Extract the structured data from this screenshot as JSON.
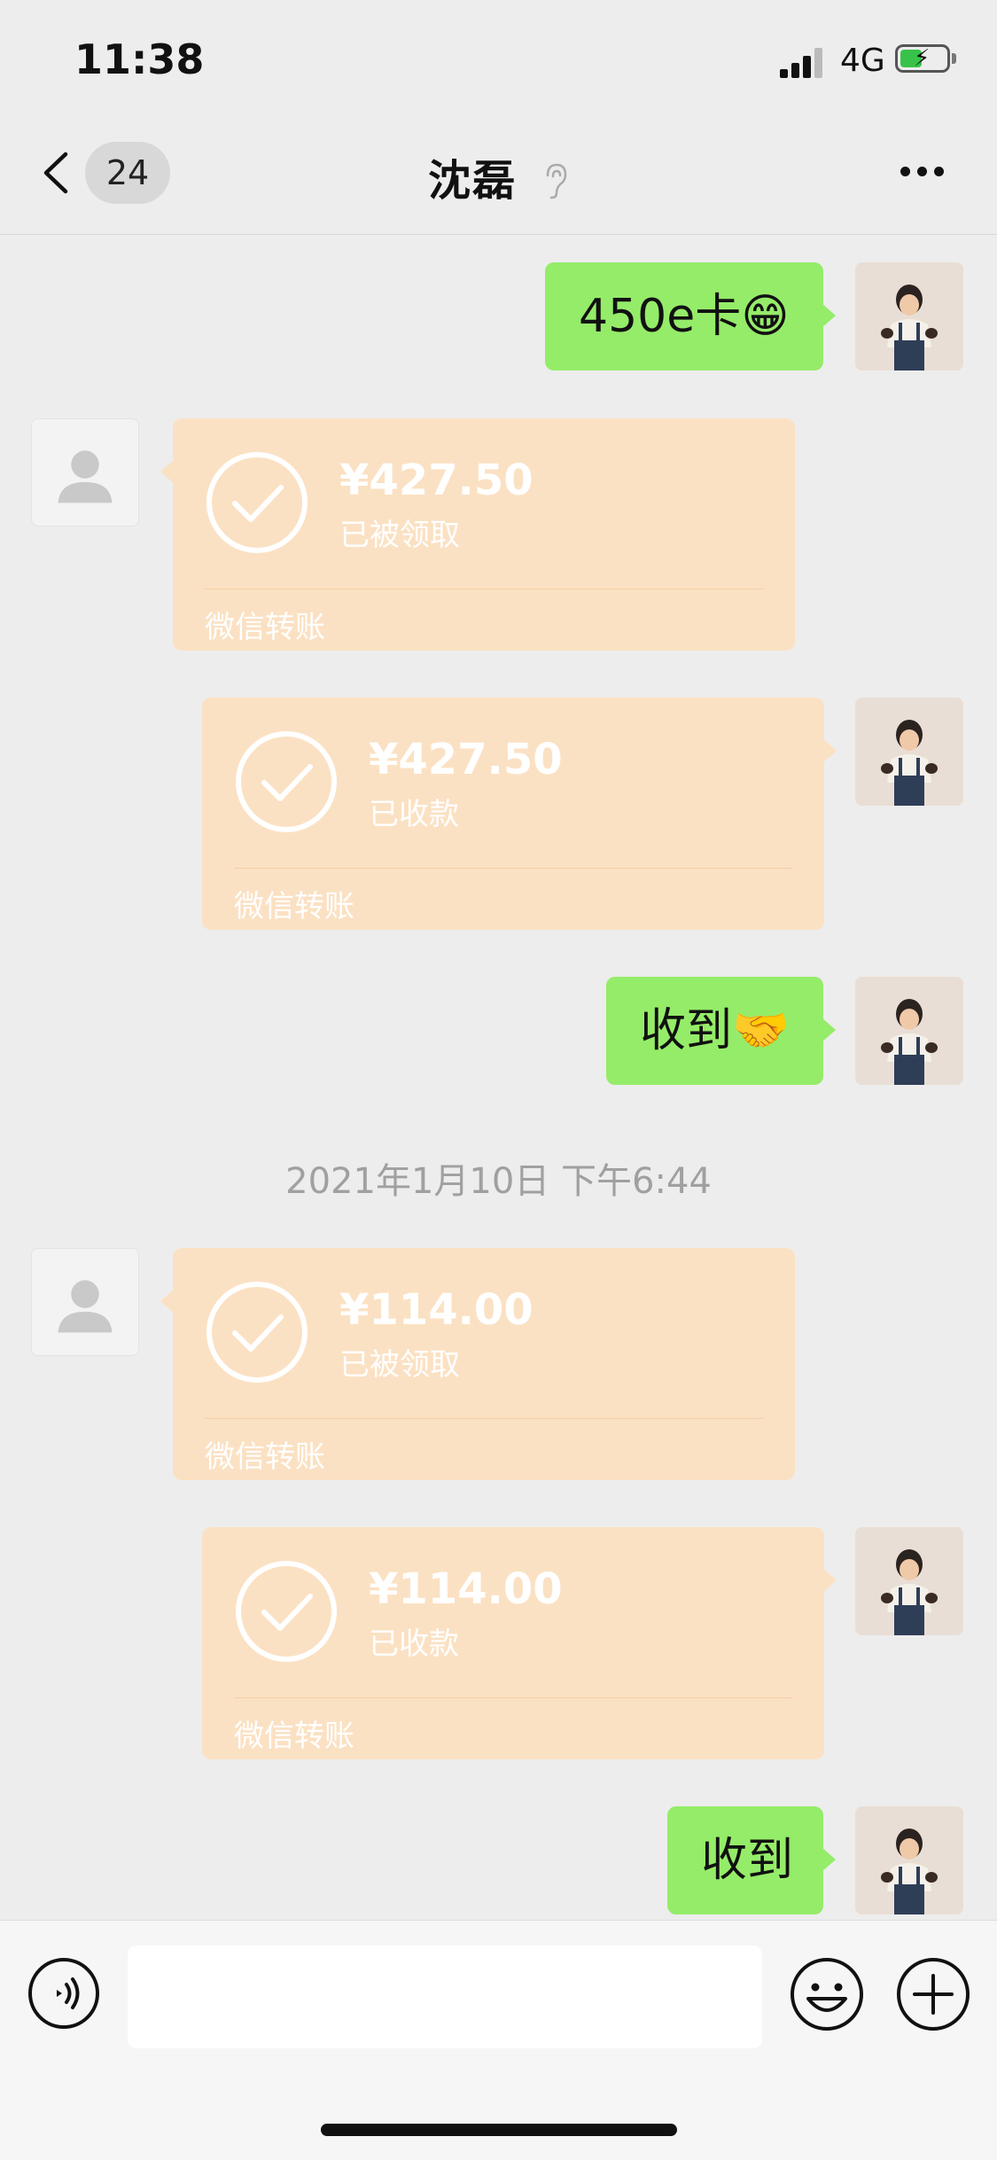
{
  "status_bar": {
    "time": "11:38",
    "network": "4G",
    "battery_color": "#37c34a"
  },
  "nav": {
    "unread_count": "24",
    "title": "沈磊",
    "back_icon": "chevron-left-icon",
    "mute_icon": "ear-muted-icon",
    "more_icon": "more-dots-icon"
  },
  "colors": {
    "sent_bubble": "#95ec69",
    "transfer_card": "#fbe1c3",
    "background": "#ededed"
  },
  "messages": [
    {
      "type": "text",
      "from": "self",
      "text": "450e卡😁"
    },
    {
      "type": "transfer",
      "from": "peer",
      "amount": "¥427.50",
      "status": "已被领取",
      "label": "微信转账"
    },
    {
      "type": "transfer",
      "from": "self",
      "amount": "¥427.50",
      "status": "已收款",
      "label": "微信转账"
    },
    {
      "type": "text",
      "from": "self",
      "text": "收到🤝"
    },
    {
      "type": "timestamp",
      "text": "2021年1月10日 下午6:44"
    },
    {
      "type": "transfer",
      "from": "peer",
      "amount": "¥114.00",
      "status": "已被领取",
      "label": "微信转账"
    },
    {
      "type": "transfer",
      "from": "self",
      "amount": "¥114.00",
      "status": "已收款",
      "label": "微信转账"
    },
    {
      "type": "text",
      "from": "self",
      "text": "收到"
    }
  ],
  "input_bar": {
    "voice_icon": "voice-input-icon",
    "emoji_icon": "emoji-icon",
    "plus_icon": "plus-icon",
    "placeholder": ""
  }
}
